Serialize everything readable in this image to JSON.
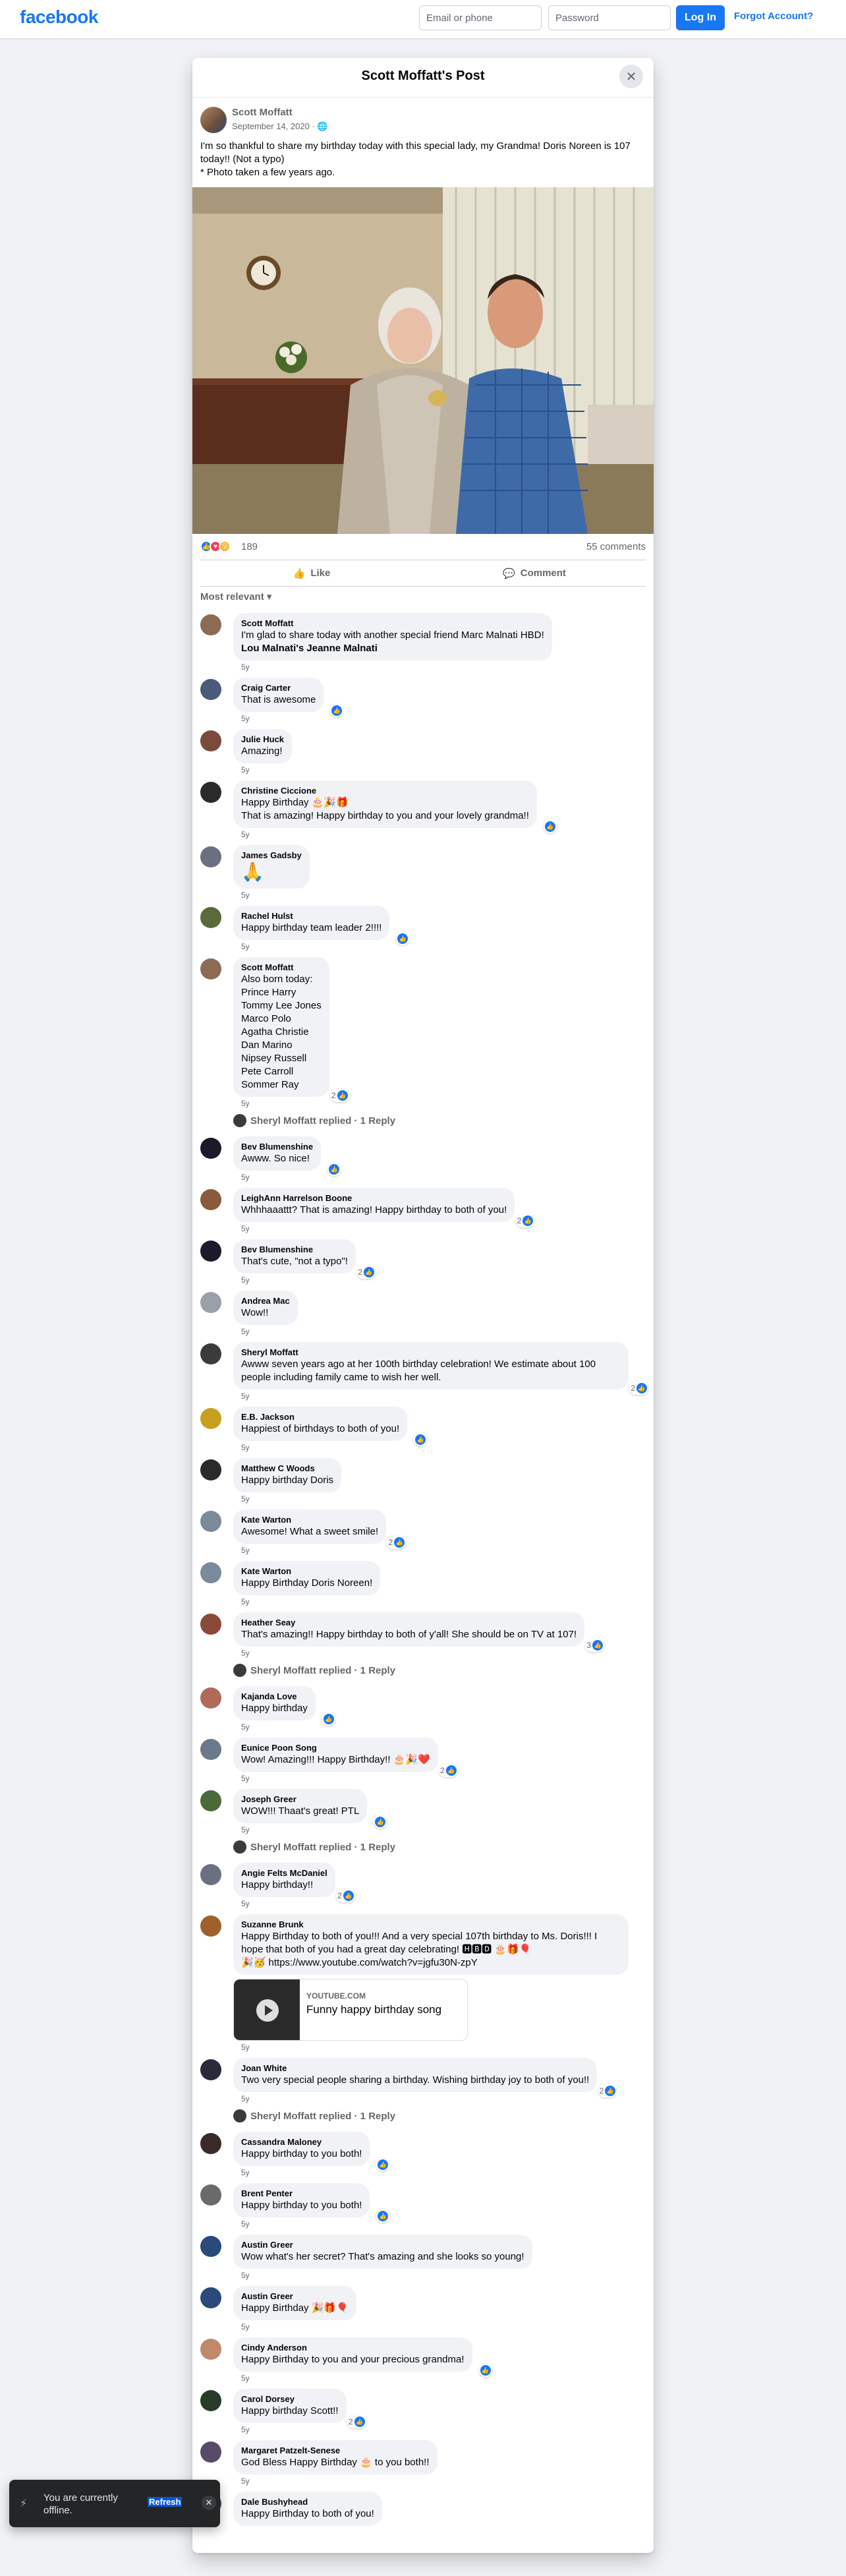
{
  "topbar": {
    "logo": "facebook",
    "email_placeholder": "Email or phone",
    "password_placeholder": "Password",
    "login_label": "Log In",
    "forgot_label": "Forgot Account?"
  },
  "modal": {
    "title": "Scott Moffatt's Post",
    "close_icon": "close-icon"
  },
  "post": {
    "author": "Scott Moffatt",
    "date": "September 14, 2020 · ",
    "privacy_icon": "globe-icon",
    "text_line1": "I'm so thankful to share my birthday today with this special lady, my Grandma! Doris Noreen is 107 today!! (Not a typo)",
    "text_line2": "* Photo taken a few years ago.",
    "reaction_count": "189",
    "comment_count": "55 comments",
    "like_label": "Like",
    "comment_label": "Comment",
    "sort_label": "Most relevant"
  },
  "comments": [
    {
      "name": "Scott Moffatt",
      "text": "I'm glad to share today with another special friend Marc Malnati HBD!",
      "bold": "Lou Malnati's Jeanne Malnati",
      "time": "5y",
      "likes": "",
      "color": "#8c6b55"
    },
    {
      "name": "Craig Carter",
      "text": "That is awesome",
      "time": "5y",
      "likes": "1",
      "color": "#4a5a7a"
    },
    {
      "name": "Julie Huck",
      "text": "Amazing!",
      "time": "5y",
      "likes": "",
      "color": "#7a4a3a"
    },
    {
      "name": "Christine Ciccione",
      "text": "Happy Birthday 🎂🎉🎁\nThat is amazing! Happy birthday to you and your lovely grandma!!",
      "time": "5y",
      "likes": "1",
      "color": "#2a2a2a"
    },
    {
      "name": "James Gadsby",
      "emoji": "🙏",
      "time": "5y",
      "likes": "",
      "color": "#6a7080"
    },
    {
      "name": "Rachel Hulst",
      "text": "Happy birthday team leader 2!!!!",
      "time": "5y",
      "likes": "1",
      "color": "#5a6a3a"
    },
    {
      "name": "Scott Moffatt",
      "text": "Also born today:\nPrince Harry\nTommy Lee Jones\nMarco Polo\nAgatha Christie\nDan Marino\nNipsey Russell\nPete Carroll\nSommer Ray",
      "time": "5y",
      "likes": "2",
      "color": "#8c6b55",
      "reply": "Sheryl Moffatt replied · 1 Reply"
    },
    {
      "name": "Bev Blumenshine",
      "text": "Awww. So nice!",
      "time": "5y",
      "likes": "1",
      "color": "#1a1a2a"
    },
    {
      "name": "LeighAnn Harrelson Boone",
      "text": "Whhhaaattt? That is amazing! Happy birthday to both of you!",
      "time": "5y",
      "likes": "2",
      "color": "#8a5a3a"
    },
    {
      "name": "Bev Blumenshine",
      "text": "That's cute, \"not a typo\"!",
      "time": "5y",
      "likes": "2",
      "color": "#1a1a2a"
    },
    {
      "name": "Andrea Mac",
      "text": "Wow!!",
      "time": "5y",
      "likes": "",
      "color": "#9aa0aa"
    },
    {
      "name": "Sheryl Moffatt",
      "text": "Awww seven years ago at her 100th birthday celebration! We estimate about 100 people including family came to wish her well.",
      "time": "5y",
      "likes": "2",
      "color": "#3b3b3b"
    },
    {
      "name": "E.B. Jackson",
      "text": "Happiest of birthdays to both of you!",
      "time": "5y",
      "likes": "1",
      "color": "#c8a020"
    },
    {
      "name": "Matthew C Woods",
      "text": "Happy birthday Doris",
      "time": "5y",
      "likes": "",
      "color": "#2a2a2a"
    },
    {
      "name": "Kate Warton",
      "text": "Awesome! What a sweet smile!",
      "time": "5y",
      "likes": "2",
      "color": "#7a8a9a"
    },
    {
      "name": "Kate Warton",
      "text": "Happy Birthday Doris Noreen!",
      "time": "5y",
      "likes": "",
      "color": "#7a8a9a"
    },
    {
      "name": "Heather Seay",
      "text": "That's amazing!! Happy birthday to both of y'all! She should be on TV at 107!",
      "time": "5y",
      "likes": "3",
      "color": "#8a4a3a",
      "reply": "Sheryl Moffatt replied · 1 Reply"
    },
    {
      "name": "Kajanda Love",
      "text": "Happy birthday",
      "time": "5y",
      "likes": "1",
      "color": "#b06a5a"
    },
    {
      "name": "Eunice Poon Song",
      "text": "Wow! Amazing!!! Happy Birthday!! 🎂🎉❤️",
      "time": "5y",
      "likes": "2",
      "color": "#6a7a8a"
    },
    {
      "name": "Joseph Greer",
      "text": "WOW!!! Thaat's great! PTL",
      "time": "5y",
      "likes": "1",
      "color": "#4a6a3a",
      "reply": "Sheryl Moffatt replied · 1 Reply"
    },
    {
      "name": "Angie Felts McDaniel",
      "text": "Happy birthday!!",
      "time": "5y",
      "likes": "2",
      "color": "#6a7080"
    },
    {
      "name": "Suzanne Brunk",
      "text": "Happy Birthday to both of you!!! And a very special 107th birthday to Ms. Doris!!! I hope that both of you had a great day celebrating! 🅷🅱🅳 🎂🎁🎈\n🎉🥳 https://www.youtube.com/watch?v=jgfu30N-zpY",
      "time": "5y",
      "likes": "",
      "color": "#a0602a",
      "link": {
        "domain": "YOUTUBE.COM",
        "title": "Funny happy birthday song"
      }
    },
    {
      "name": "Joan White",
      "text": "Two very special people sharing a birthday. Wishing birthday joy to both of you!!",
      "time": "5y",
      "likes": "2",
      "color": "#2a2a3a",
      "reply": "Sheryl Moffatt replied · 1 Reply"
    },
    {
      "name": "Cassandra Maloney",
      "text": "Happy birthday to you both!",
      "time": "5y",
      "likes": "1",
      "color": "#3a2a2a"
    },
    {
      "name": "Brent Penter",
      "text": "Happy birthday to you both!",
      "time": "5y",
      "likes": "1",
      "color": "#6a6a6a"
    },
    {
      "name": "Austin Greer",
      "text": "Wow what's her secret? That's amazing and she looks so young!",
      "time": "5y",
      "likes": "",
      "color": "#2a4a7a"
    },
    {
      "name": "Austin Greer",
      "text": "Happy Birthday 🎉🎁🎈",
      "time": "5y",
      "likes": "",
      "color": "#2a4a7a"
    },
    {
      "name": "Cindy Anderson",
      "text": "Happy Birthday to you and your precious grandma!",
      "time": "5y",
      "likes": "1",
      "color": "#c08a6a"
    },
    {
      "name": "Carol Dorsey",
      "text": "Happy birthday Scott!!",
      "time": "5y",
      "likes": "2",
      "color": "#2a3a2a"
    },
    {
      "name": "Margaret Patzelt-Senese",
      "text": "God Bless Happy Birthday 🎂 to you both!!",
      "time": "5y",
      "likes": "",
      "color": "#5a4a6a"
    },
    {
      "name": "Dale Bushyhead",
      "text": "Happy Birthday to both of you!",
      "time": "",
      "likes": "",
      "color": "#4a4a4a"
    }
  ],
  "toast": {
    "text": "You are currently offline.",
    "refresh_label": "Refresh",
    "icon": "wifi-off-icon"
  }
}
